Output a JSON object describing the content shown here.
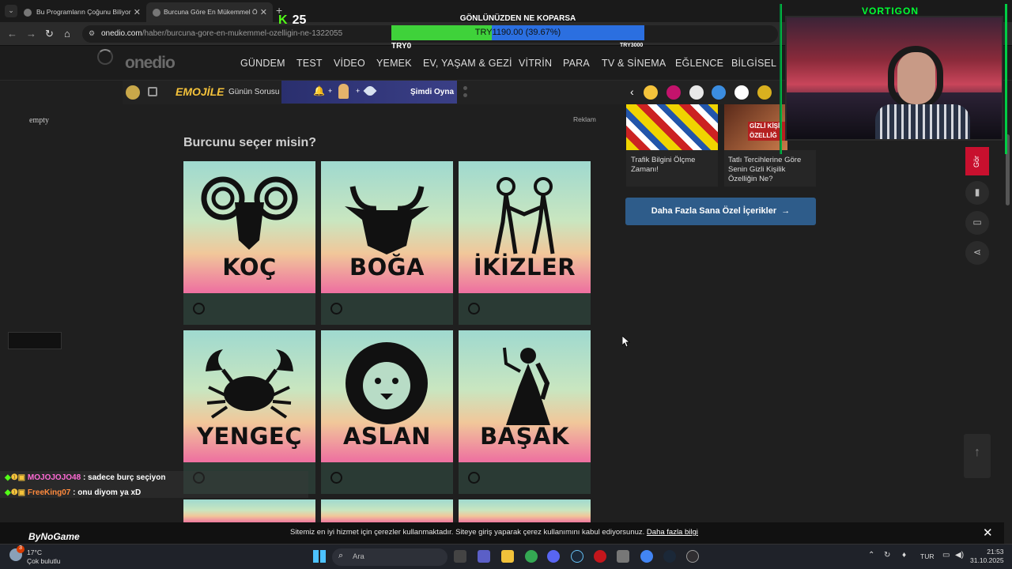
{
  "browser": {
    "tabs": [
      {
        "label": "Bu Programların Çoğunu Biliyor",
        "active": false
      },
      {
        "label": "Burcuna Göre En Mükemmel Ö",
        "active": true
      }
    ],
    "url_host": "onedio.com",
    "url_path": "/haber/burcuna-gore-en-mukemmel-ozelligin-ne-1322055"
  },
  "site": {
    "logo": "onedio",
    "nav": [
      "GÜNDEM",
      "TEST",
      "VİDEO",
      "YEMEK",
      "EV, YAŞAM & GEZİ",
      "VİTRİN",
      "PARA",
      "TV & SİNEMA",
      "EĞLENCE",
      "BİLGİSEL"
    ],
    "subbar": {
      "emojile": "EMOJİLE",
      "daily": "Günün Sorusu",
      "play": "Şimdi Oyna"
    }
  },
  "main": {
    "left_placeholder": "empty",
    "ad_label": "Reklam",
    "question": "Burcunu seçer misin?",
    "options": [
      "KOÇ",
      "BOĞA",
      "İKİZLER",
      "YENGEÇ",
      "ASLAN",
      "BAŞAK"
    ]
  },
  "sidebar": {
    "recommended": [
      {
        "title": "Trafik Bilgini Ölçme Zamanı!"
      },
      {
        "title": "Tatlı Tercihlerine Göre Senin Gizli Kişilik Özelliğin Ne?",
        "image_text": "GİZLİ KİŞİ ÖZELLİĞ"
      }
    ],
    "more_button": "Daha Fazla Sana Özel İçerikler",
    "float_label": "Gör"
  },
  "stream": {
    "kick_label": "K",
    "kick_count": "25",
    "progress_title": "GÖNLÜNÜZDEN NE KOPARSA",
    "progress_text": "TRY1190.00 (39.67%)",
    "progress_fraction": 0.3967,
    "progress_min": "TRY0",
    "progress_max": "TRY3000",
    "cam_name": "VORTIGON",
    "chat": [
      {
        "user": "MOJOJOJO48",
        "message": ": sadece burç seçiyon"
      },
      {
        "user": "FreeKing07",
        "message": ": onu diyom ya xD"
      }
    ],
    "sponsor": "ByNoGame"
  },
  "cookie": {
    "text": "Sitemiz en iyi hizmet için çerezler kullanmaktadır. Siteye giriş yaparak çerez kullanımını kabul ediyorsunuz.",
    "link": "Daha fazla bilgi"
  },
  "taskbar": {
    "weather_temp": "17°C",
    "weather_desc": "Çok bulutlu",
    "weather_badge": "3",
    "search_placeholder": "Ara",
    "language": "TUR",
    "time": "21:53",
    "date": "31.10.2025"
  },
  "colors": {
    "accent_blue": "#2e5c8a",
    "kick_green": "#53fc18",
    "progress_green": "#3fd23a",
    "progress_blue": "#2b6fe0",
    "float_red": "#c8102e"
  }
}
